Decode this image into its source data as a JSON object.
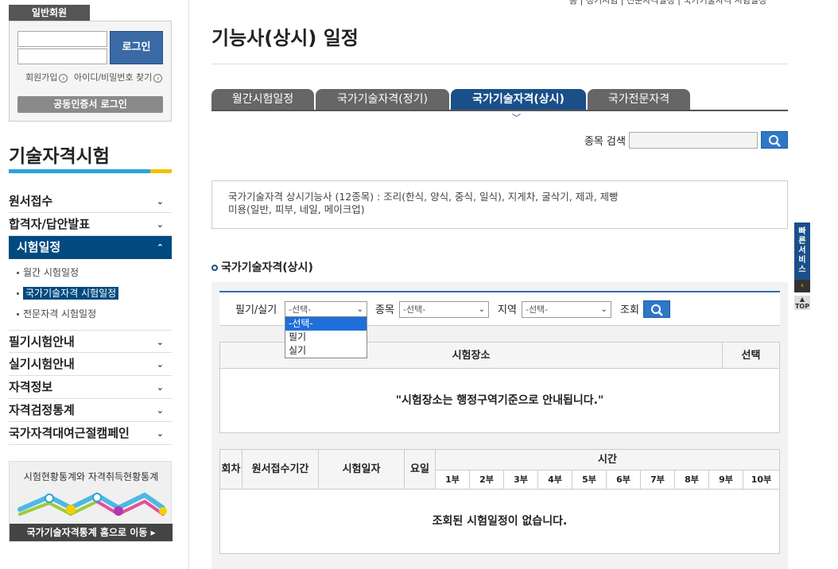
{
  "member": {
    "tab_label": "일반회원",
    "login_label": "로그인",
    "join_label": "회원가입",
    "find_label": "아이디/비밀번호 찾기",
    "cert_login_label": "공동인증서 로그인"
  },
  "sidebar": {
    "section_title": "기술자격시험",
    "items": [
      {
        "label": "원서접수"
      },
      {
        "label": "합격자/답안발표"
      },
      {
        "label": "시험일정"
      },
      {
        "label": "필기시험안내"
      },
      {
        "label": "실기시험안내"
      },
      {
        "label": "자격정보"
      },
      {
        "label": "자격검정통계"
      },
      {
        "label": "국가자격대여근절캠페인"
      }
    ],
    "sub_items": [
      {
        "label": "월간 시험일정"
      },
      {
        "label": "국가기술자격 시험일정"
      },
      {
        "label": "전문자격 시험일정"
      }
    ],
    "banner": {
      "title": "시험현황통계와 자격취득현황통계",
      "link_label": "국가기술자격통계 홈으로 이동"
    }
  },
  "breadcrumb": {
    "text": "홈 | 정기시험 | 전문자격일정 | 국가기술자격 시험일정"
  },
  "page_title": "기능사(상시) 일정",
  "tabs": [
    {
      "label": "월간시험일정"
    },
    {
      "label": "국가기술자격(정기)"
    },
    {
      "label": "국가기술자격(상시)"
    },
    {
      "label": "국가전문자격"
    }
  ],
  "search": {
    "label": "종목 검색",
    "value": ""
  },
  "notice": {
    "line1": "국가기술자격 상시기능사 (12종목) : 조리(한식, 양식, 중식, 일식), 지게차, 굴삭기, 제과, 제빵",
    "line2": "미용(일반, 피부, 네일, 메이크업)"
  },
  "section_heading": "국가기술자격(상시)",
  "filters": {
    "type_label": "필기/실기",
    "type_value": "-선택-",
    "subject_label": "종목",
    "subject_value": "-선택-",
    "region_label": "지역",
    "region_value": "-선택-",
    "search_label": "조회",
    "type_options": [
      "-선택-",
      "필기",
      "실기"
    ]
  },
  "venue_table": {
    "col_venue": "시험장소",
    "col_select": "선택",
    "message": "\"시험장소는 행정구역기준으로 안내됩니다.\""
  },
  "schedule_table": {
    "col_round": "회차",
    "col_period": "원서접수기간",
    "col_date": "시험일자",
    "col_day": "요일",
    "col_time": "시간",
    "parts": [
      "1부",
      "2부",
      "3부",
      "4부",
      "5부",
      "6부",
      "7부",
      "8부",
      "9부",
      "10부"
    ],
    "message": "조회된 시험일정이 없습니다."
  },
  "quick": {
    "label": "빠른서비스",
    "top_label": "TOP"
  }
}
